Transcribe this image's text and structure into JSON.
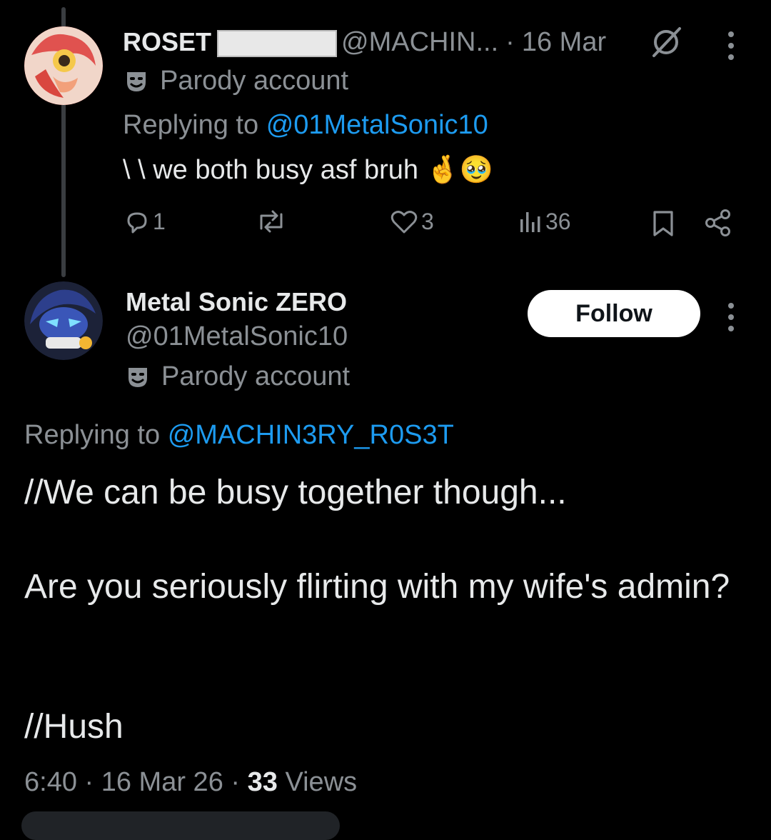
{
  "parent_tweet": {
    "display_name": "ROSET",
    "handle": "@MACHIN...",
    "separator": "·",
    "date": "16 Mar",
    "badge": "Parody account",
    "replying_prefix": "Replying to",
    "replying_handle": "@01MetalSonic10",
    "text": "\\ \\ we both busy asf bruh 🤞🥹",
    "reply_count": "1",
    "like_count": "3",
    "view_count": "36"
  },
  "main_tweet": {
    "display_name": "Metal Sonic ZERO",
    "handle": "@01MetalSonic10",
    "badge": "Parody account",
    "follow_label": "Follow",
    "replying_prefix": "Replying to",
    "replying_handle": "@MACHIN3RY_R0S3T",
    "line1": "//We can be busy together though...",
    "line2": "Are you seriously flirting with my wife's admin?",
    "line3": "//Hush",
    "meta_time": "6:40 · 16 Mar 26 ·",
    "meta_views_count": "33",
    "meta_views_label": "Views"
  },
  "colors": {
    "link": "#1d9bf0",
    "muted": "#8b9095",
    "text": "#e7e9ea",
    "background": "#000000"
  }
}
